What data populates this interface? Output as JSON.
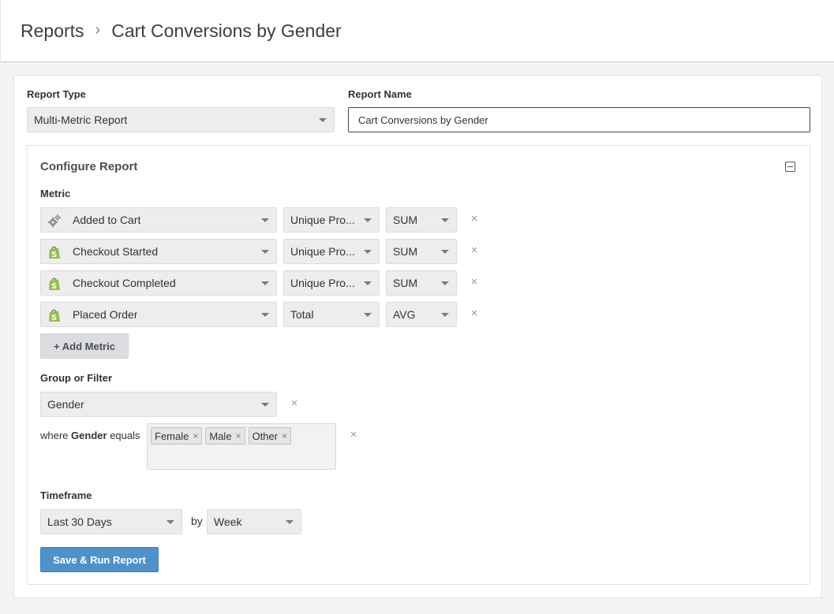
{
  "breadcrumb": {
    "root": "Reports",
    "separator": "›",
    "current": "Cart Conversions by Gender"
  },
  "report_type": {
    "label": "Report Type",
    "value": "Multi-Metric Report"
  },
  "report_name": {
    "label": "Report Name",
    "value": "Cart Conversions by Gender"
  },
  "configure": {
    "title": "Configure Report",
    "metric_label": "Metric",
    "metrics": [
      {
        "name": "Added to Cart",
        "icon": "gears-icon",
        "measure": "Unique Pro...",
        "agg": "SUM"
      },
      {
        "name": "Checkout Started",
        "icon": "shopify-icon",
        "measure": "Unique Pro...",
        "agg": "SUM"
      },
      {
        "name": "Checkout Completed",
        "icon": "shopify-icon",
        "measure": "Unique Pro...",
        "agg": "SUM"
      },
      {
        "name": "Placed Order",
        "icon": "shopify-icon",
        "measure": "Total",
        "agg": "AVG"
      }
    ],
    "add_metric_label": "+ Add Metric",
    "group_label": "Group or Filter",
    "group_value": "Gender",
    "where": {
      "prefix": "where",
      "field": "Gender",
      "op": "equals"
    },
    "tags": [
      "Female",
      "Male",
      "Other"
    ],
    "timeframe_label": "Timeframe",
    "timeframe_value": "Last 30 Days",
    "by_text": "by",
    "interval_value": "Week",
    "save_label": "Save & Run Report"
  },
  "icons": {
    "remove": "×"
  },
  "colors": {
    "accent": "#4e92cc",
    "shopify": "#95bf47",
    "breadcrumb_sep": "#5aa05a"
  }
}
